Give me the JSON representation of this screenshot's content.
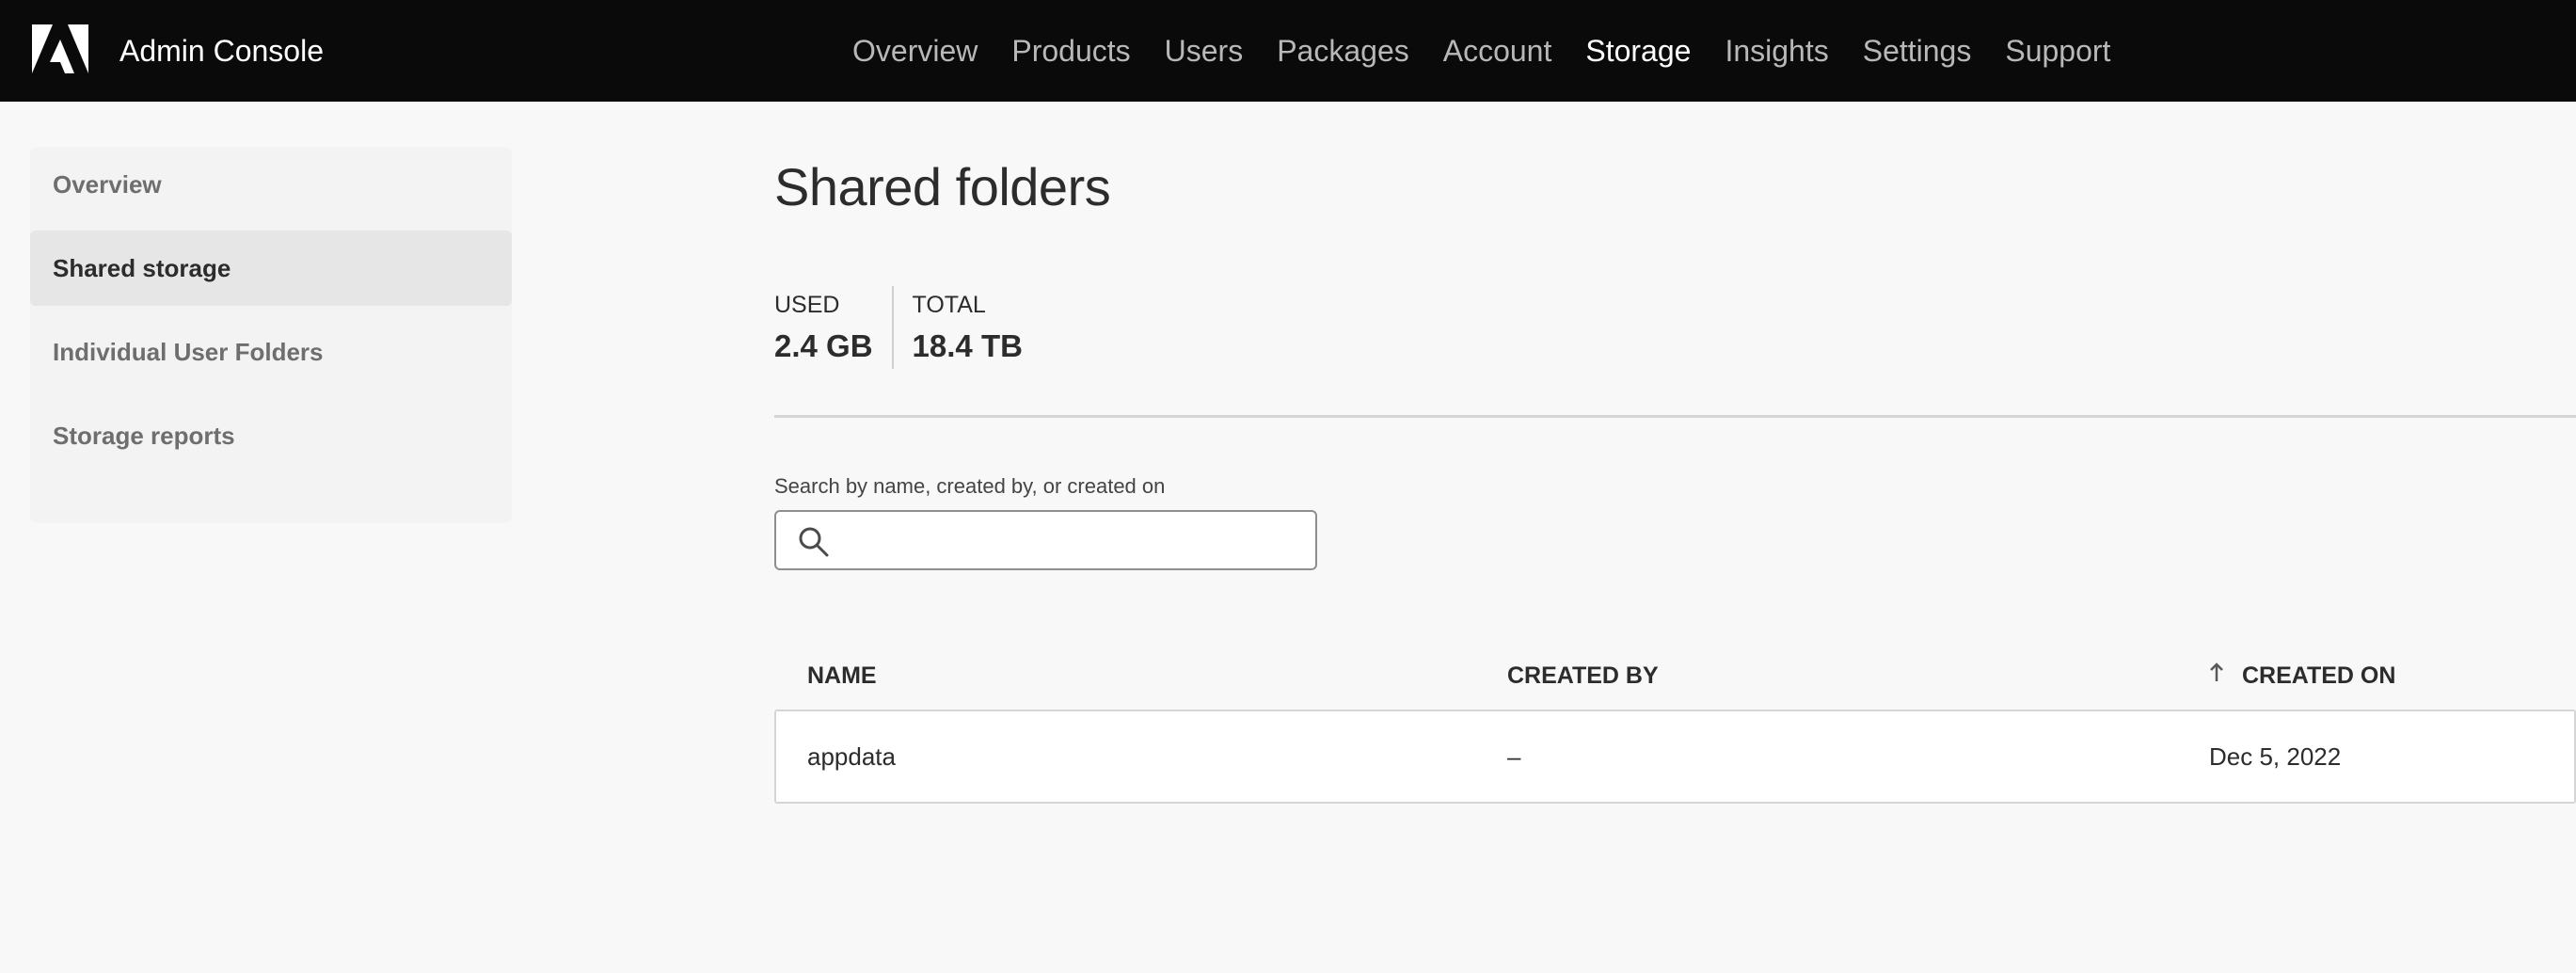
{
  "header": {
    "app_title": "Admin Console",
    "logo_icon": "adobe-logo-icon",
    "nav": [
      {
        "label": "Overview",
        "active": false
      },
      {
        "label": "Products",
        "active": false
      },
      {
        "label": "Users",
        "active": false
      },
      {
        "label": "Packages",
        "active": false
      },
      {
        "label": "Account",
        "active": false
      },
      {
        "label": "Storage",
        "active": true
      },
      {
        "label": "Insights",
        "active": false
      },
      {
        "label": "Settings",
        "active": false
      },
      {
        "label": "Support",
        "active": false
      }
    ]
  },
  "sidebar": {
    "items": [
      {
        "label": "Overview",
        "active": false
      },
      {
        "label": "Shared storage",
        "active": true
      },
      {
        "label": "Individual User Folders",
        "active": false
      },
      {
        "label": "Storage reports",
        "active": false
      }
    ]
  },
  "main": {
    "title": "Shared folders",
    "stats": {
      "used_label": "USED",
      "used_value": "2.4 GB",
      "total_label": "TOTAL",
      "total_value": "18.4 TB"
    },
    "search": {
      "label": "Search by name, created by, or created on",
      "value": "",
      "placeholder": ""
    },
    "table": {
      "columns": [
        "NAME",
        "CREATED BY",
        "CREATED ON"
      ],
      "sort_icon": "arrow-up-icon",
      "rows": [
        {
          "name": "appdata",
          "created_by": "–",
          "created_on": "Dec 5, 2022"
        }
      ]
    }
  },
  "colors": {
    "header_bg": "#0a0a0a",
    "page_bg": "#f8f8f8",
    "sidebar_active_bg": "#e6e6e6"
  }
}
